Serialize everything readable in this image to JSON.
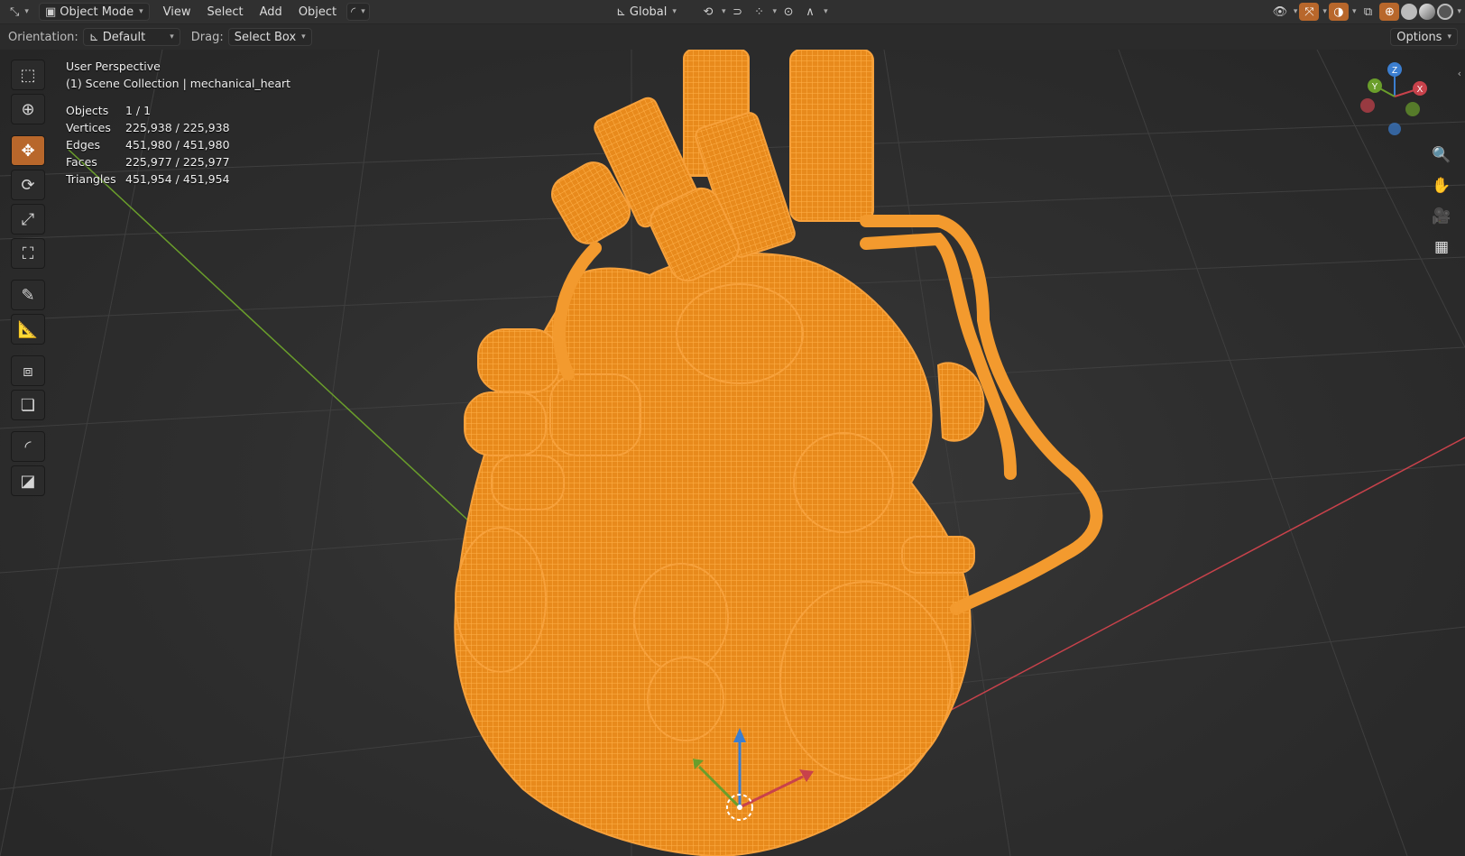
{
  "header": {
    "editor_icon": "transform-icon",
    "mode": "Object Mode",
    "menus": [
      "View",
      "Select",
      "Add",
      "Object"
    ],
    "transform_orientation": "Global",
    "options_label": "Options"
  },
  "tool_header": {
    "orientation_label": "Orientation:",
    "orientation_value": "Default",
    "drag_label": "Drag:",
    "drag_value": "Select Box"
  },
  "viewport": {
    "view_name": "User Perspective",
    "collection_line": "(1) Scene Collection | mechanical_heart",
    "stats": [
      {
        "label": "Objects",
        "value": "1 / 1"
      },
      {
        "label": "Vertices",
        "value": "225,938 / 225,938"
      },
      {
        "label": "Edges",
        "value": "451,980 / 451,980"
      },
      {
        "label": "Faces",
        "value": "225,977 / 225,977"
      },
      {
        "label": "Triangles",
        "value": "451,954 / 451,954"
      }
    ],
    "selection_color": "#f39a2e",
    "gizmo_axes": [
      "X",
      "Y",
      "Z"
    ]
  },
  "toolbar": {
    "tools": [
      "select-box-icon",
      "cursor-icon",
      "move-icon",
      "rotate-icon",
      "scale-icon",
      "transform-icon",
      "annotate-icon",
      "measure-icon",
      "add-cube-icon",
      "add-object-icon",
      "curve-icon",
      "image-icon"
    ],
    "active_tool": "move-icon"
  },
  "colors": {
    "accent": "#4772b3",
    "active_tool": "#b8672b",
    "axis_x": "#c8424b",
    "axis_y": "#6a9e2b",
    "axis_z": "#3b7ed0"
  }
}
